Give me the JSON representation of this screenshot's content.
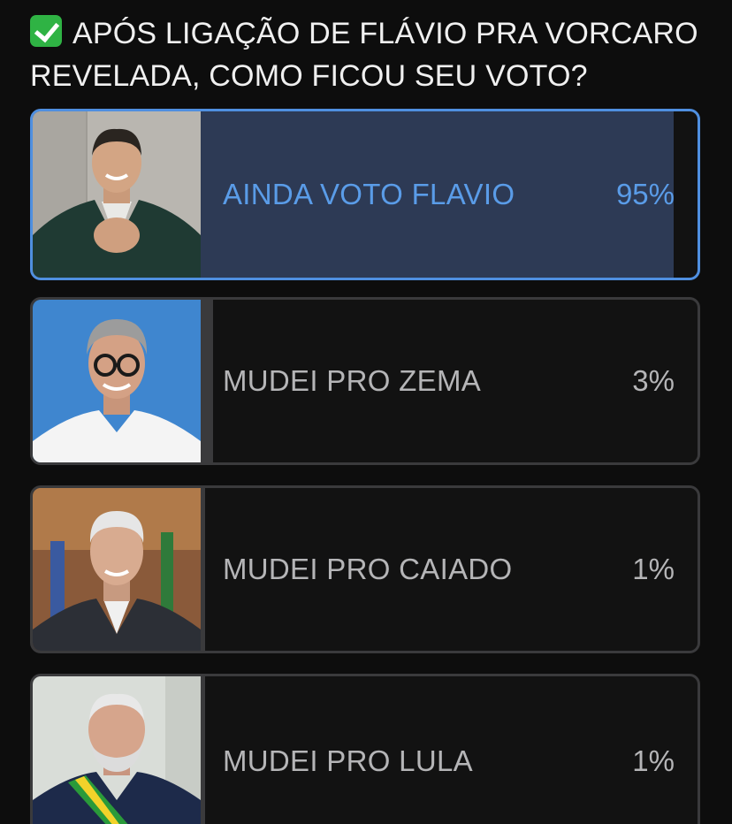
{
  "question": {
    "text": "APÓS LIGAÇÃO DE FLÁVIO PRA VORCARO REVELADA, COMO FICOU SEU VOTO?"
  },
  "colors": {
    "selected_border": "#4f8fe0",
    "selected_fill": "#2d3a55",
    "selected_text": "#5a9ce8",
    "option_fill": "#3a3a3c",
    "option_text": "#b5b5b7",
    "background": "#0d0d0d"
  },
  "options": [
    {
      "label": "AINDA VOTO FLAVIO",
      "percent": "95%",
      "value": 95,
      "selected": true
    },
    {
      "label": "MUDEI PRO ZEMA",
      "percent": "3%",
      "value": 3,
      "selected": false
    },
    {
      "label": "MUDEI PRO CAIADO",
      "percent": "1%",
      "value": 1,
      "selected": false
    },
    {
      "label": "MUDEI PRO LULA",
      "percent": "1%",
      "value": 1,
      "selected": false
    }
  ]
}
